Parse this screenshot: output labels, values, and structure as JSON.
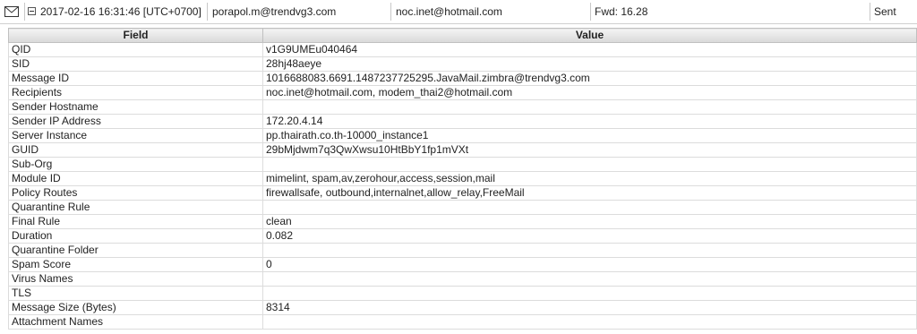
{
  "summary": {
    "icon": "envelope-icon",
    "toggle_icon": "minus-box-icon",
    "timestamp": "2017-02-16 16:31:46 [UTC+0700]",
    "sender": "porapol.m@trendvg3.com",
    "recipient": "noc.inet@hotmail.com",
    "action": "Fwd: 16.28",
    "status": "Sent"
  },
  "table": {
    "columns": [
      "Field",
      "Value"
    ],
    "rows": [
      {
        "field": "QID",
        "value": "v1G9UMEu040464"
      },
      {
        "field": "SID",
        "value": "28hj48aeye"
      },
      {
        "field": "Message ID",
        "value": "1016688083.6691.1487237725295.JavaMail.zimbra@trendvg3.com"
      },
      {
        "field": "Recipients",
        "value": "noc.inet@hotmail.com, modem_thai2@hotmail.com"
      },
      {
        "field": "Sender Hostname",
        "value": ""
      },
      {
        "field": "Sender IP Address",
        "value": "172.20.4.14"
      },
      {
        "field": "Server Instance",
        "value": "pp.thairath.co.th-10000_instance1"
      },
      {
        "field": "GUID",
        "value": "29bMjdwm7q3QwXwsu10HtBbY1fp1mVXt"
      },
      {
        "field": "Sub-Org",
        "value": ""
      },
      {
        "field": "Module ID",
        "value": "mimelint, spam,av,zerohour,access,session,mail"
      },
      {
        "field": "Policy Routes",
        "value": "firewallsafe, outbound,internalnet,allow_relay,FreeMail"
      },
      {
        "field": "Quarantine Rule",
        "value": ""
      },
      {
        "field": "Final Rule",
        "value": "clean"
      },
      {
        "field": "Duration",
        "value": "0.082"
      },
      {
        "field": "Quarantine Folder",
        "value": ""
      },
      {
        "field": "Spam Score",
        "value": "0"
      },
      {
        "field": "Virus Names",
        "value": ""
      },
      {
        "field": "TLS",
        "value": ""
      },
      {
        "field": "Message Size (Bytes)",
        "value": "8314"
      },
      {
        "field": "Attachment Names",
        "value": ""
      }
    ]
  }
}
